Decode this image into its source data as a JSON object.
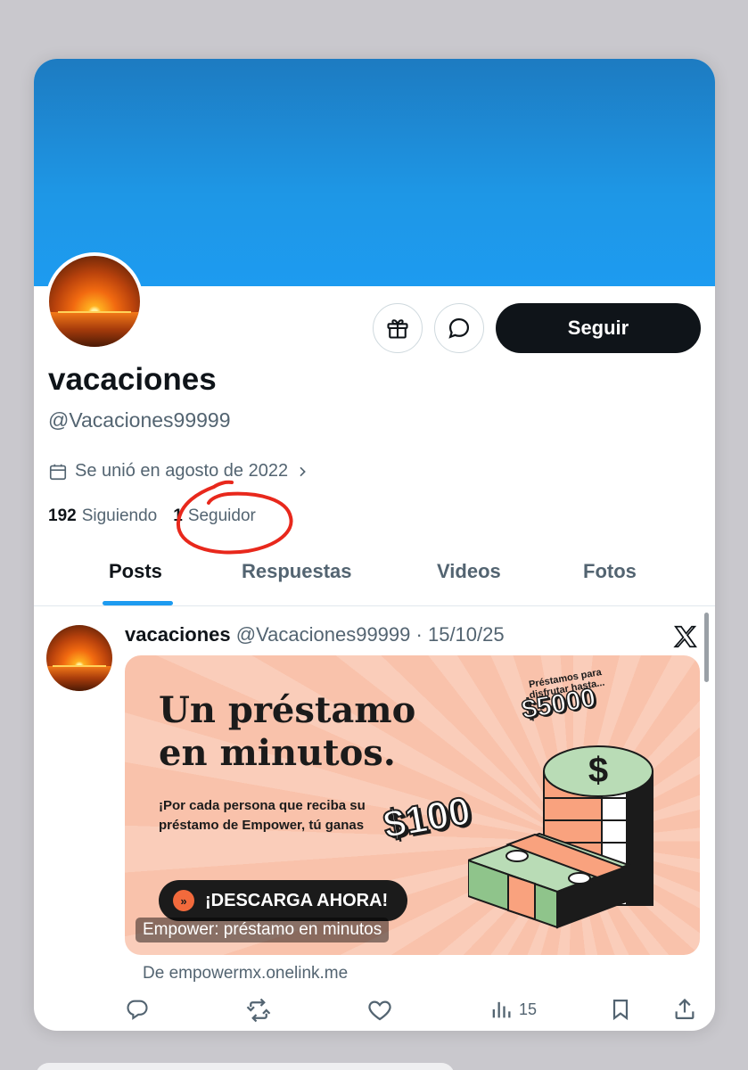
{
  "profile": {
    "display_name": "vacaciones",
    "handle": "@Vacaciones99999",
    "joined": "Se unió en agosto de 2022",
    "following_count": "192",
    "following_label": "Siguiendo",
    "followers_count": "1",
    "followers_label": "Seguidor",
    "follow_label": "Seguir"
  },
  "colors": {
    "banner": "#1d9bf0",
    "accent": "#1d9bf0",
    "follow_bg": "#0f1419",
    "annotation": "#e8281c"
  },
  "tabs": [
    {
      "label": "Posts",
      "active": true
    },
    {
      "label": "Respuestas",
      "active": false
    },
    {
      "label": "Videos",
      "active": false
    },
    {
      "label": "Fotos",
      "active": false
    }
  ],
  "post": {
    "author": "vacaciones",
    "handle": "@Vacaciones99999",
    "separator": "·",
    "date": "15/10/25",
    "ad": {
      "title_line1": "Un préstamo",
      "title_line2": "en minutos.",
      "body": "¡Por cada persona que reciba su préstamo de Empower, tú ganas",
      "amount_small": "$100",
      "promo_small": "Préstamos para disfrutar hasta...",
      "amount_big": "$5000",
      "cta": "¡DESCARGA AHORA!",
      "caption": "Empower: préstamo en minutos"
    },
    "source": "De empowermx.onelink.me",
    "views": "15"
  },
  "icons": [
    "gift-icon",
    "message-icon",
    "calendar-icon",
    "chevron-right-icon",
    "x-logo-icon",
    "reply-icon",
    "repost-icon",
    "like-icon",
    "views-icon",
    "bookmark-icon",
    "share-icon"
  ]
}
